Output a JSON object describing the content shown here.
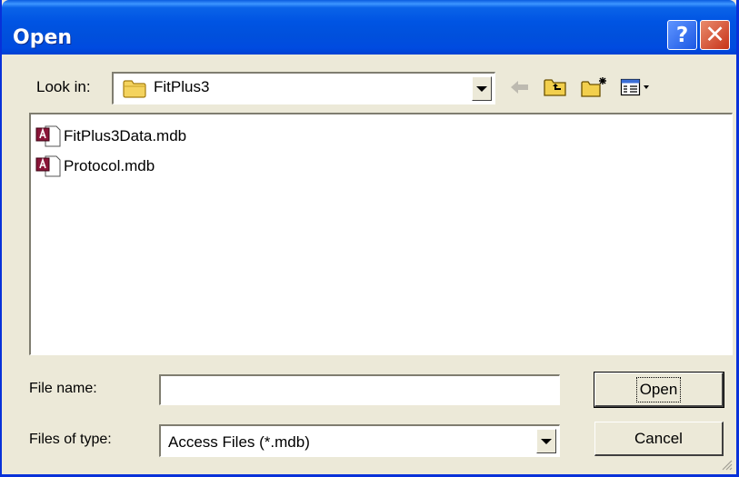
{
  "window": {
    "title": "Open",
    "help_symbol": "?",
    "close_symbol": "✕"
  },
  "toolbar": {
    "lookin_label": "Look in:",
    "lookin_value": "FitPlus3",
    "icons": [
      "folder-icon",
      "back-arrow-icon",
      "up-one-level-icon",
      "new-folder-icon",
      "view-menu-icon"
    ]
  },
  "files": [
    {
      "name": "FitPlus3Data.mdb",
      "icon": "access-db-icon"
    },
    {
      "name": "Protocol.mdb",
      "icon": "access-db-icon"
    }
  ],
  "form": {
    "filename_label": "File name:",
    "filename_value": "",
    "filetype_label": "Files of type:",
    "filetype_value": "Access Files (*.mdb)"
  },
  "buttons": {
    "open": "Open",
    "cancel": "Cancel"
  }
}
